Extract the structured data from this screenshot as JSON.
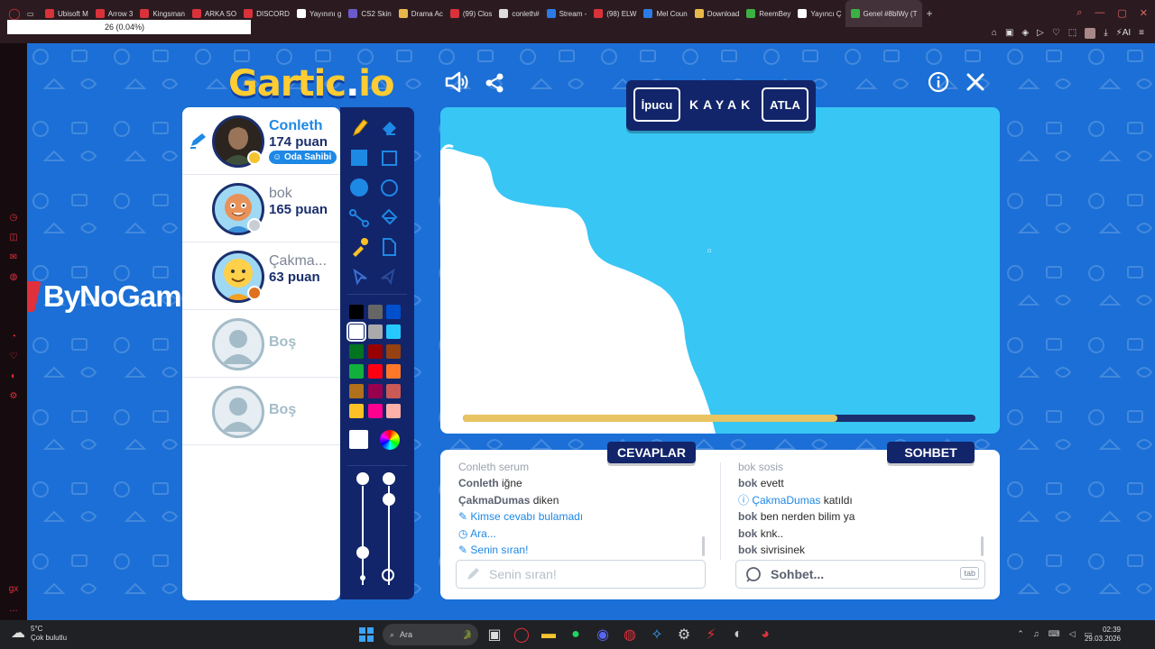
{
  "browser": {
    "tabs": [
      {
        "label": "Ubisoft M",
        "color": "#d9323b"
      },
      {
        "label": "Arrow 3",
        "color": "#d9323b"
      },
      {
        "label": "Kingsman",
        "color": "#d9323b"
      },
      {
        "label": "ARKA SO",
        "color": "#d9323b"
      },
      {
        "label": "DISCORD",
        "color": "#d9323b"
      },
      {
        "label": "Yayınını g",
        "color": "#ffffff"
      },
      {
        "label": "CS2 Skin",
        "color": "#6a5acd"
      },
      {
        "label": "Drama Ac",
        "color": "#e8b84a"
      },
      {
        "label": "(99) Clos",
        "color": "#d9323b"
      },
      {
        "label": "conleth#",
        "color": "#dddddd"
      },
      {
        "label": "Stream -",
        "color": "#2c7be5"
      },
      {
        "label": "(98) ELW",
        "color": "#d9323b"
      },
      {
        "label": "Mel Coun",
        "color": "#2c7be5"
      },
      {
        "label": "Download",
        "color": "#e8b84a"
      },
      {
        "label": "ReemBey",
        "color": "#3cb043"
      },
      {
        "label": "Yayıncı Ç",
        "color": "#ffffff"
      },
      {
        "label": "Genel #8blWy (T",
        "color": "#3cb043",
        "active": true
      }
    ],
    "zoom_text": "26 (0.04%)"
  },
  "logo": {
    "part1": "Gartic",
    "part2": ".",
    "part3": "io"
  },
  "sponsor": {
    "text": "ByNoGame"
  },
  "players": [
    {
      "name": "Conleth",
      "score": "174 puan",
      "badge": "Oda Sahibi",
      "drawing": true,
      "status_color": "#f4c430"
    },
    {
      "name": "bok",
      "score": "165 puan",
      "status_color": "#c9ced6"
    },
    {
      "name": "Çakma...",
      "score": "63 puan",
      "status_color": "#e07020"
    },
    {
      "name": "Boş"
    },
    {
      "name": "Boş"
    }
  ],
  "palette": {
    "colors": [
      "#000000",
      "#666666",
      "#0050cd",
      "#ffffff",
      "#aaaaaa",
      "#26c9ff",
      "#017420",
      "#990000",
      "#964112",
      "#11b03c",
      "#ff0013",
      "#ff7829",
      "#b0701c",
      "#99004e",
      "#cb5a57",
      "#ffc126",
      "#ff008f",
      "#feafa8"
    ],
    "selected_index": 3,
    "current_color": "#ffffff"
  },
  "hint": {
    "hint_button": "İpucu",
    "word": "KAYAK",
    "skip_button": "ATLA"
  },
  "timer": {
    "progress": 0.73
  },
  "answers": {
    "title": "CEVAPLAR",
    "messages": [
      {
        "who": "Conleth",
        "text": "serum",
        "faded": true
      },
      {
        "who": "Conleth",
        "text": "iğne"
      },
      {
        "who": "ÇakmaDumas",
        "text": "diken"
      },
      {
        "system": true,
        "icon": "pencil",
        "text": "Kimse cevabı bulamadı"
      },
      {
        "system": true,
        "icon": "clock",
        "text": "Ara..."
      },
      {
        "system": true,
        "icon": "pencil",
        "text": "Senin sıran!"
      }
    ],
    "placeholder": "Senin sıran!"
  },
  "chat": {
    "title": "SOHBET",
    "messages": [
      {
        "who": "bok",
        "text": "sosis",
        "faded": true
      },
      {
        "who": "bok",
        "text": "evett"
      },
      {
        "system": true,
        "icon": "info",
        "who": "ÇakmaDumas",
        "text": "katıldı"
      },
      {
        "who": "bok",
        "text": "ben nerden bilim ya"
      },
      {
        "who": "bok",
        "text": "knk.."
      },
      {
        "who": "bok",
        "text": "sivrisinek"
      }
    ],
    "placeholder": "Sohbet...",
    "kbd": "tab"
  },
  "taskbar": {
    "weather_temp": "5°C",
    "weather_desc": "Çok bulutlu",
    "search": "Ara",
    "time": "02:39",
    "date": "29.03.2026"
  }
}
